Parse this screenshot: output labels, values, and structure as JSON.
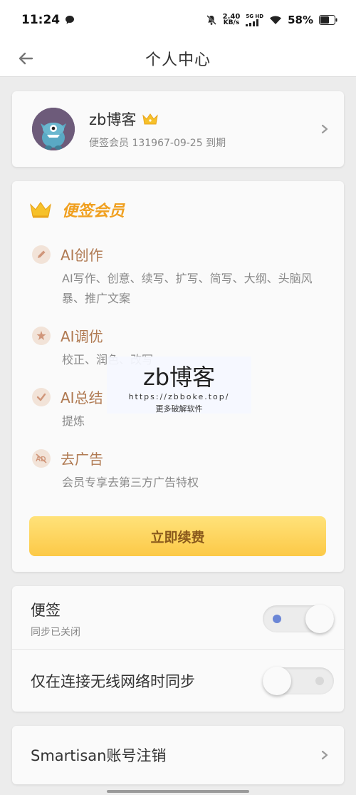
{
  "status_bar": {
    "time": "11:24",
    "net_speed_value": "2.40",
    "net_speed_unit": "KB/s",
    "signal_label": "5G HD",
    "battery": "58%"
  },
  "nav": {
    "title": "个人中心"
  },
  "profile": {
    "name": "zb博客",
    "membership_line": "便签会员 131967-09-25 到期"
  },
  "membership": {
    "title": "便签会员",
    "features": [
      {
        "title": "AI创作",
        "desc": "AI写作、创意、续写、扩写、简写、大纲、头脑风暴、推广文案",
        "icon": "pencil-icon"
      },
      {
        "title": "AI调优",
        "desc": "校正、润色、改写",
        "icon": "magic-icon"
      },
      {
        "title": "AI总结",
        "desc": "提炼",
        "icon": "check-icon"
      },
      {
        "title": "去广告",
        "desc": "会员专享去第三方广告特权",
        "icon": "no-ads-icon"
      }
    ],
    "renew_label": "立即续费"
  },
  "watermark": {
    "title": "zb博客",
    "url": "https://zbboke.top/",
    "subtitle": "更多破解软件"
  },
  "sync": {
    "notes_title": "便签",
    "notes_status": "同步已关闭",
    "notes_toggle_on": true,
    "wifi_only_label": "仅在连接无线网络时同步",
    "wifi_only_toggle_on": false
  },
  "account": {
    "delete_label": "Smartisan账号注销"
  },
  "colors": {
    "accent_gold": "#f0a020",
    "feature_brown": "#b07a52",
    "toggle_on_dot": "#6b86d6"
  }
}
